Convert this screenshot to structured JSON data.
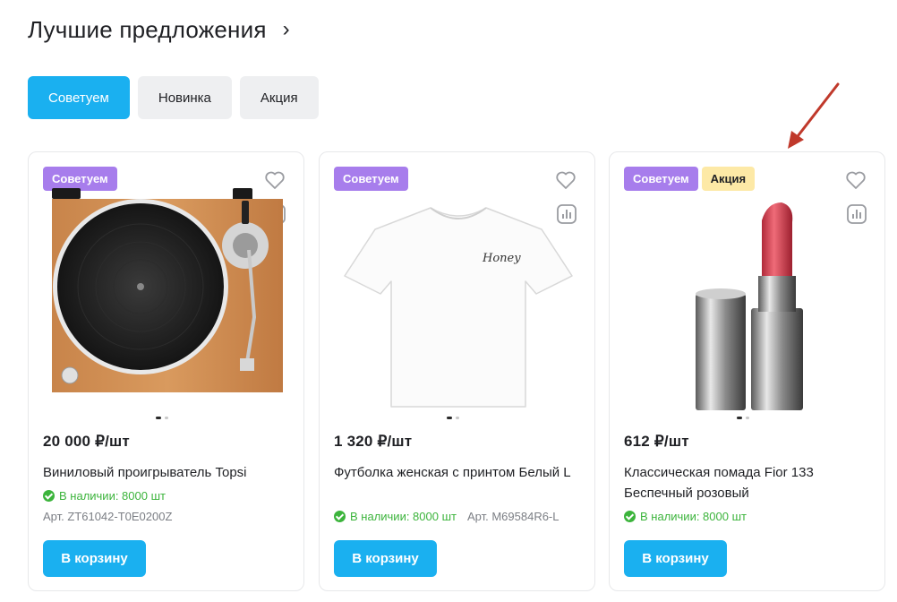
{
  "header": {
    "title": "Лучшие предложения",
    "more_icon": "chevron-right-icon"
  },
  "filters": [
    {
      "label": "Советуем",
      "active": true
    },
    {
      "label": "Новинка",
      "active": false
    },
    {
      "label": "Акция",
      "active": false
    }
  ],
  "products": [
    {
      "badges": [
        "Советуем"
      ],
      "image": "vinyl-turntable",
      "price": "20 000 ₽/шт",
      "title": "Виниловый проигрыватель Topsi",
      "stock": "В наличии: 8000 шт",
      "article": "Арт.  ZT61042-T0E0200Z",
      "cart_label": "В корзину"
    },
    {
      "badges": [
        "Советуем"
      ],
      "image": "white-t-shirt",
      "shirt_text": "Honey",
      "price": "1 320 ₽/шт",
      "title": "Футболка женская с принтом Белый L",
      "stock": "В наличии: 8000 шт",
      "article": "Арт. M69584R6-L",
      "cart_label": "В корзину"
    },
    {
      "badges": [
        "Советуем",
        "Акция"
      ],
      "image": "red-lipstick",
      "price": "612 ₽/шт",
      "title": "Классическая помада Fior 133 Беспечный розовый",
      "stock": "В наличии: 8000 шт",
      "cart_label": "В корзину"
    }
  ],
  "colors": {
    "accent": "#1ab0f0",
    "badge_recommend": "#a77dec",
    "badge_sale": "#fde9a6",
    "in_stock": "#3cb43c",
    "annotation_arrow": "#c0392b"
  }
}
